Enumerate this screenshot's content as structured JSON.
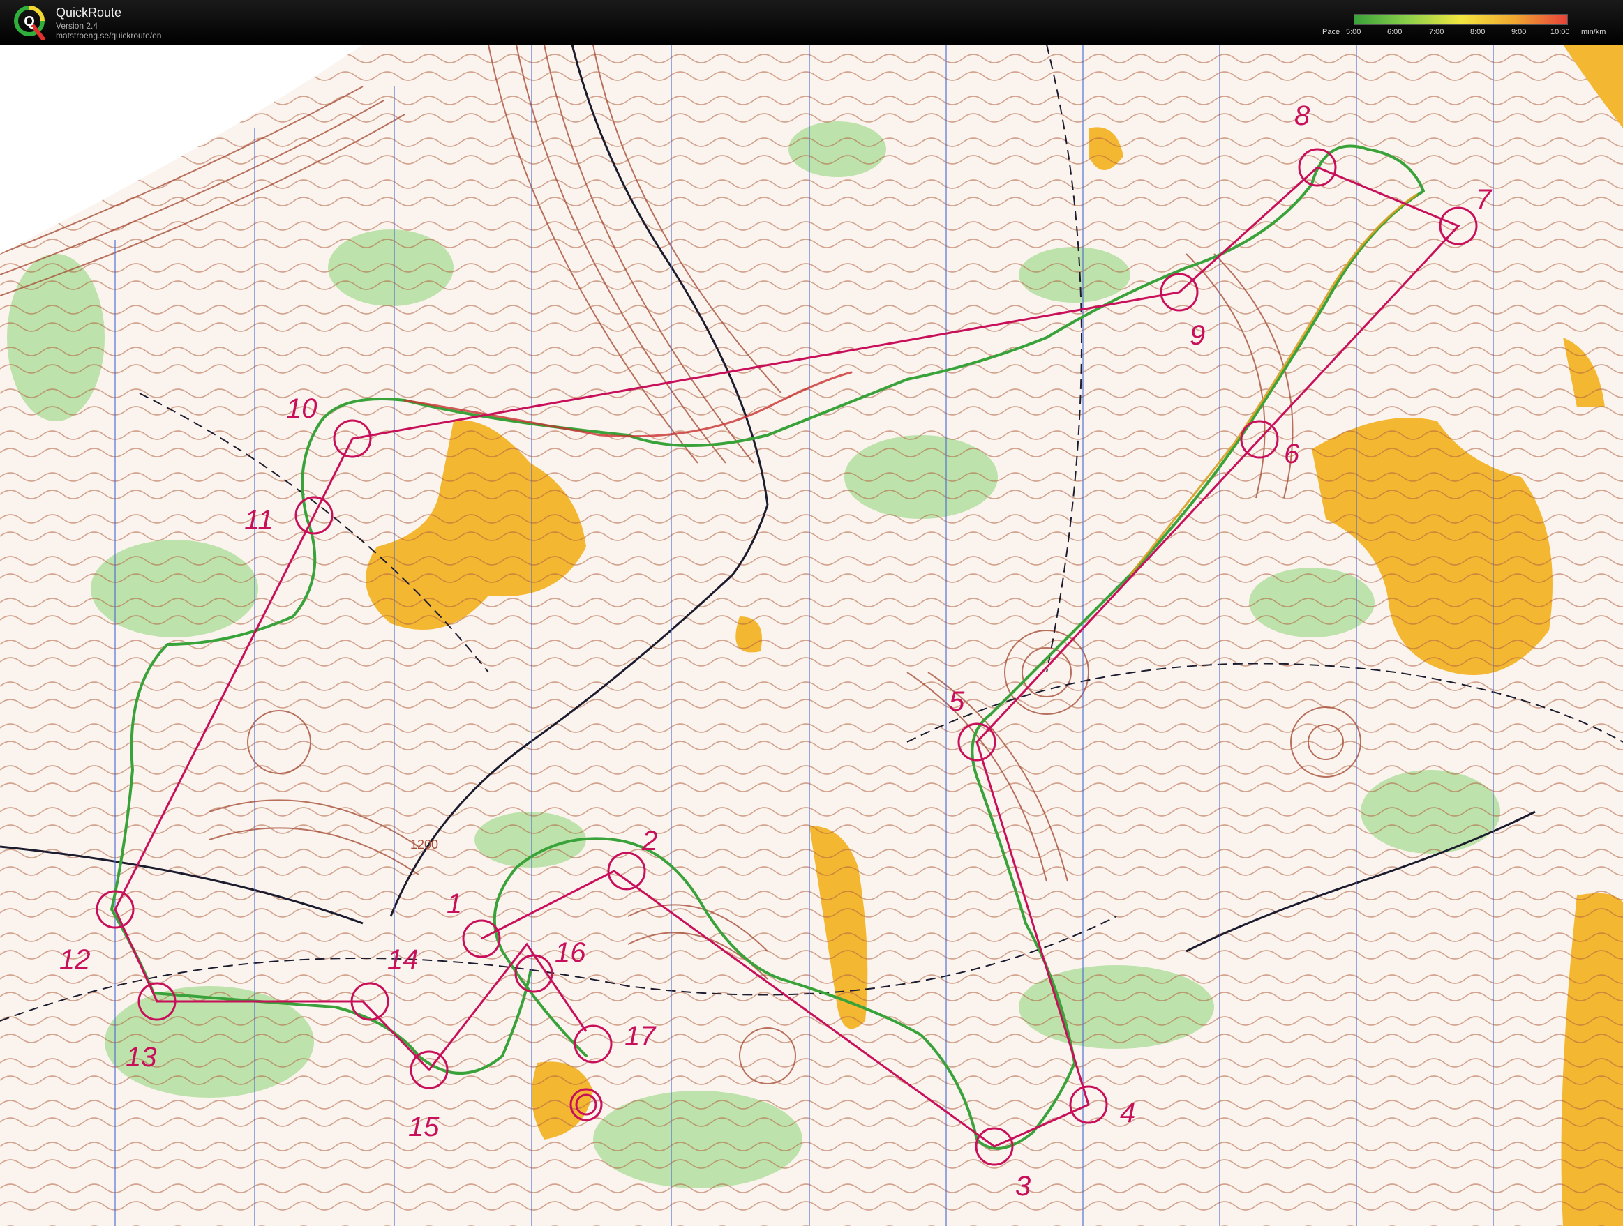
{
  "app": {
    "title": "QuickRoute",
    "version": "Version 2.4",
    "url": "matstroeng.se/quickroute/en",
    "logo_letter": "Q"
  },
  "pace_legend": {
    "label": "Pace",
    "unit": "min/km",
    "ticks": [
      "5:00",
      "6:00",
      "7:00",
      "8:00",
      "9:00",
      "10:00"
    ],
    "colors": [
      "#3aa23a",
      "#8ad04a",
      "#f2e640",
      "#f0a830",
      "#e8423a"
    ]
  },
  "map": {
    "control_labels": [
      "1",
      "2",
      "3",
      "4",
      "5",
      "6",
      "7",
      "8",
      "9",
      "10",
      "11",
      "12",
      "13",
      "14",
      "15",
      "16",
      "17"
    ],
    "elevation_label": "1200",
    "course_color": "#c8105a",
    "route_colors": [
      "#3aa23a",
      "#d8a020",
      "#c83030"
    ]
  }
}
